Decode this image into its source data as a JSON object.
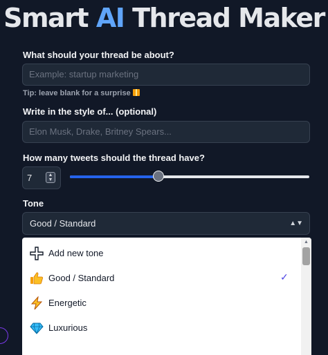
{
  "header": {
    "title_part1": "Smart ",
    "title_accent": "AI",
    "title_part2": " Thread Maker"
  },
  "topic": {
    "label": "What should your thread be about?",
    "placeholder": "Example: startup marketing",
    "tip": "Tip: leave blank for a surprise"
  },
  "style": {
    "label": "Write in the style of... (optional)",
    "placeholder": "Elon Musk, Drake, Britney Spears..."
  },
  "tweets": {
    "label": "How many tweets should the thread have?",
    "value": "7",
    "slider_fraction": 0.37
  },
  "tone": {
    "label": "Tone",
    "selected": "Good / Standard",
    "options": [
      {
        "label": "Add new tone",
        "icon": "plus-icon",
        "selected": false
      },
      {
        "label": "Good / Standard",
        "icon": "thumbs-up-icon",
        "selected": true
      },
      {
        "label": "Energetic",
        "icon": "lightning-icon",
        "selected": false
      },
      {
        "label": "Luxurious",
        "icon": "diamond-icon",
        "selected": false
      }
    ]
  },
  "colors": {
    "background": "#111827",
    "accent": "#60a5fa",
    "slider": "#2563eb",
    "check": "#4f46e5"
  }
}
